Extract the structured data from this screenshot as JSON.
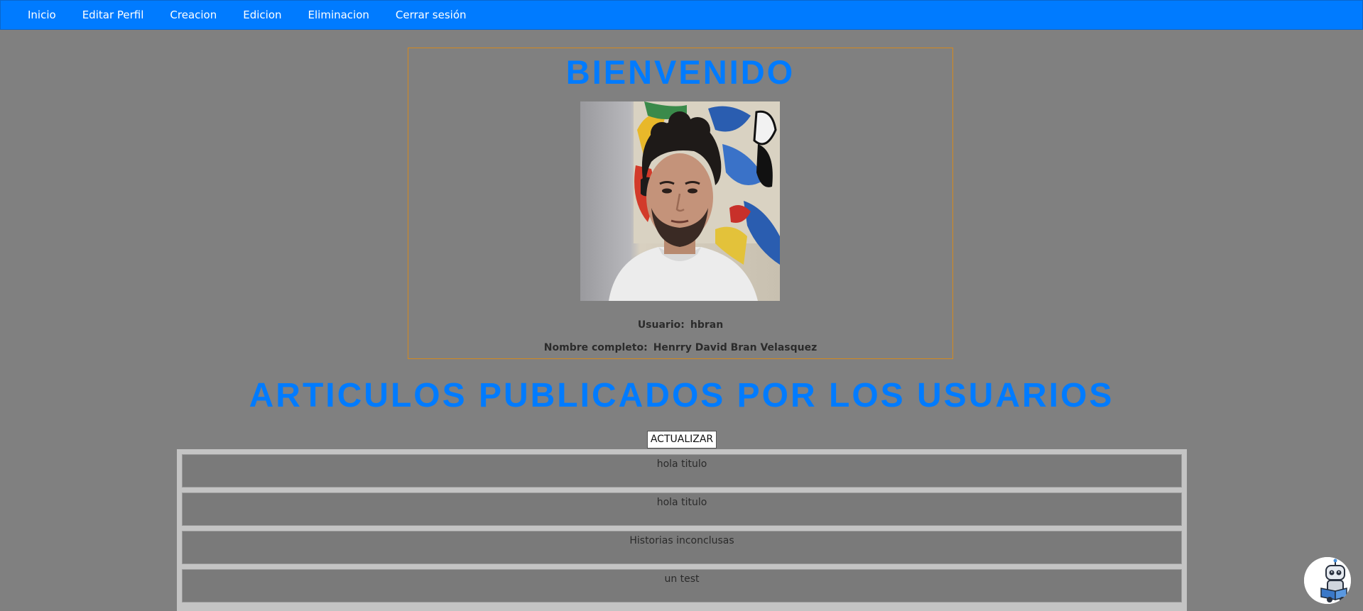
{
  "nav": {
    "items": [
      {
        "label": "Inicio"
      },
      {
        "label": "Editar Perfil"
      },
      {
        "label": "Creacion"
      },
      {
        "label": "Edicion"
      },
      {
        "label": "Eliminacion"
      },
      {
        "label": "Cerrar sesión"
      }
    ]
  },
  "profile": {
    "title": "BIENVENIDO",
    "username_label": "Usuario:",
    "username": "hbran",
    "fullname_label": "Nombre completo:",
    "fullname": "Henrry David Bran Velasquez"
  },
  "articles": {
    "title": "ARTICULOS PUBLICADOS POR LOS USUARIOS",
    "refresh_label": "ACTUALIZAR",
    "items": [
      {
        "title": "hola titulo"
      },
      {
        "title": "hola titulo"
      },
      {
        "title": "Historias inconclusas"
      },
      {
        "title": "un test"
      }
    ]
  },
  "colors": {
    "accent": "#007bff",
    "background": "#808080",
    "box_border": "#d4891f"
  }
}
